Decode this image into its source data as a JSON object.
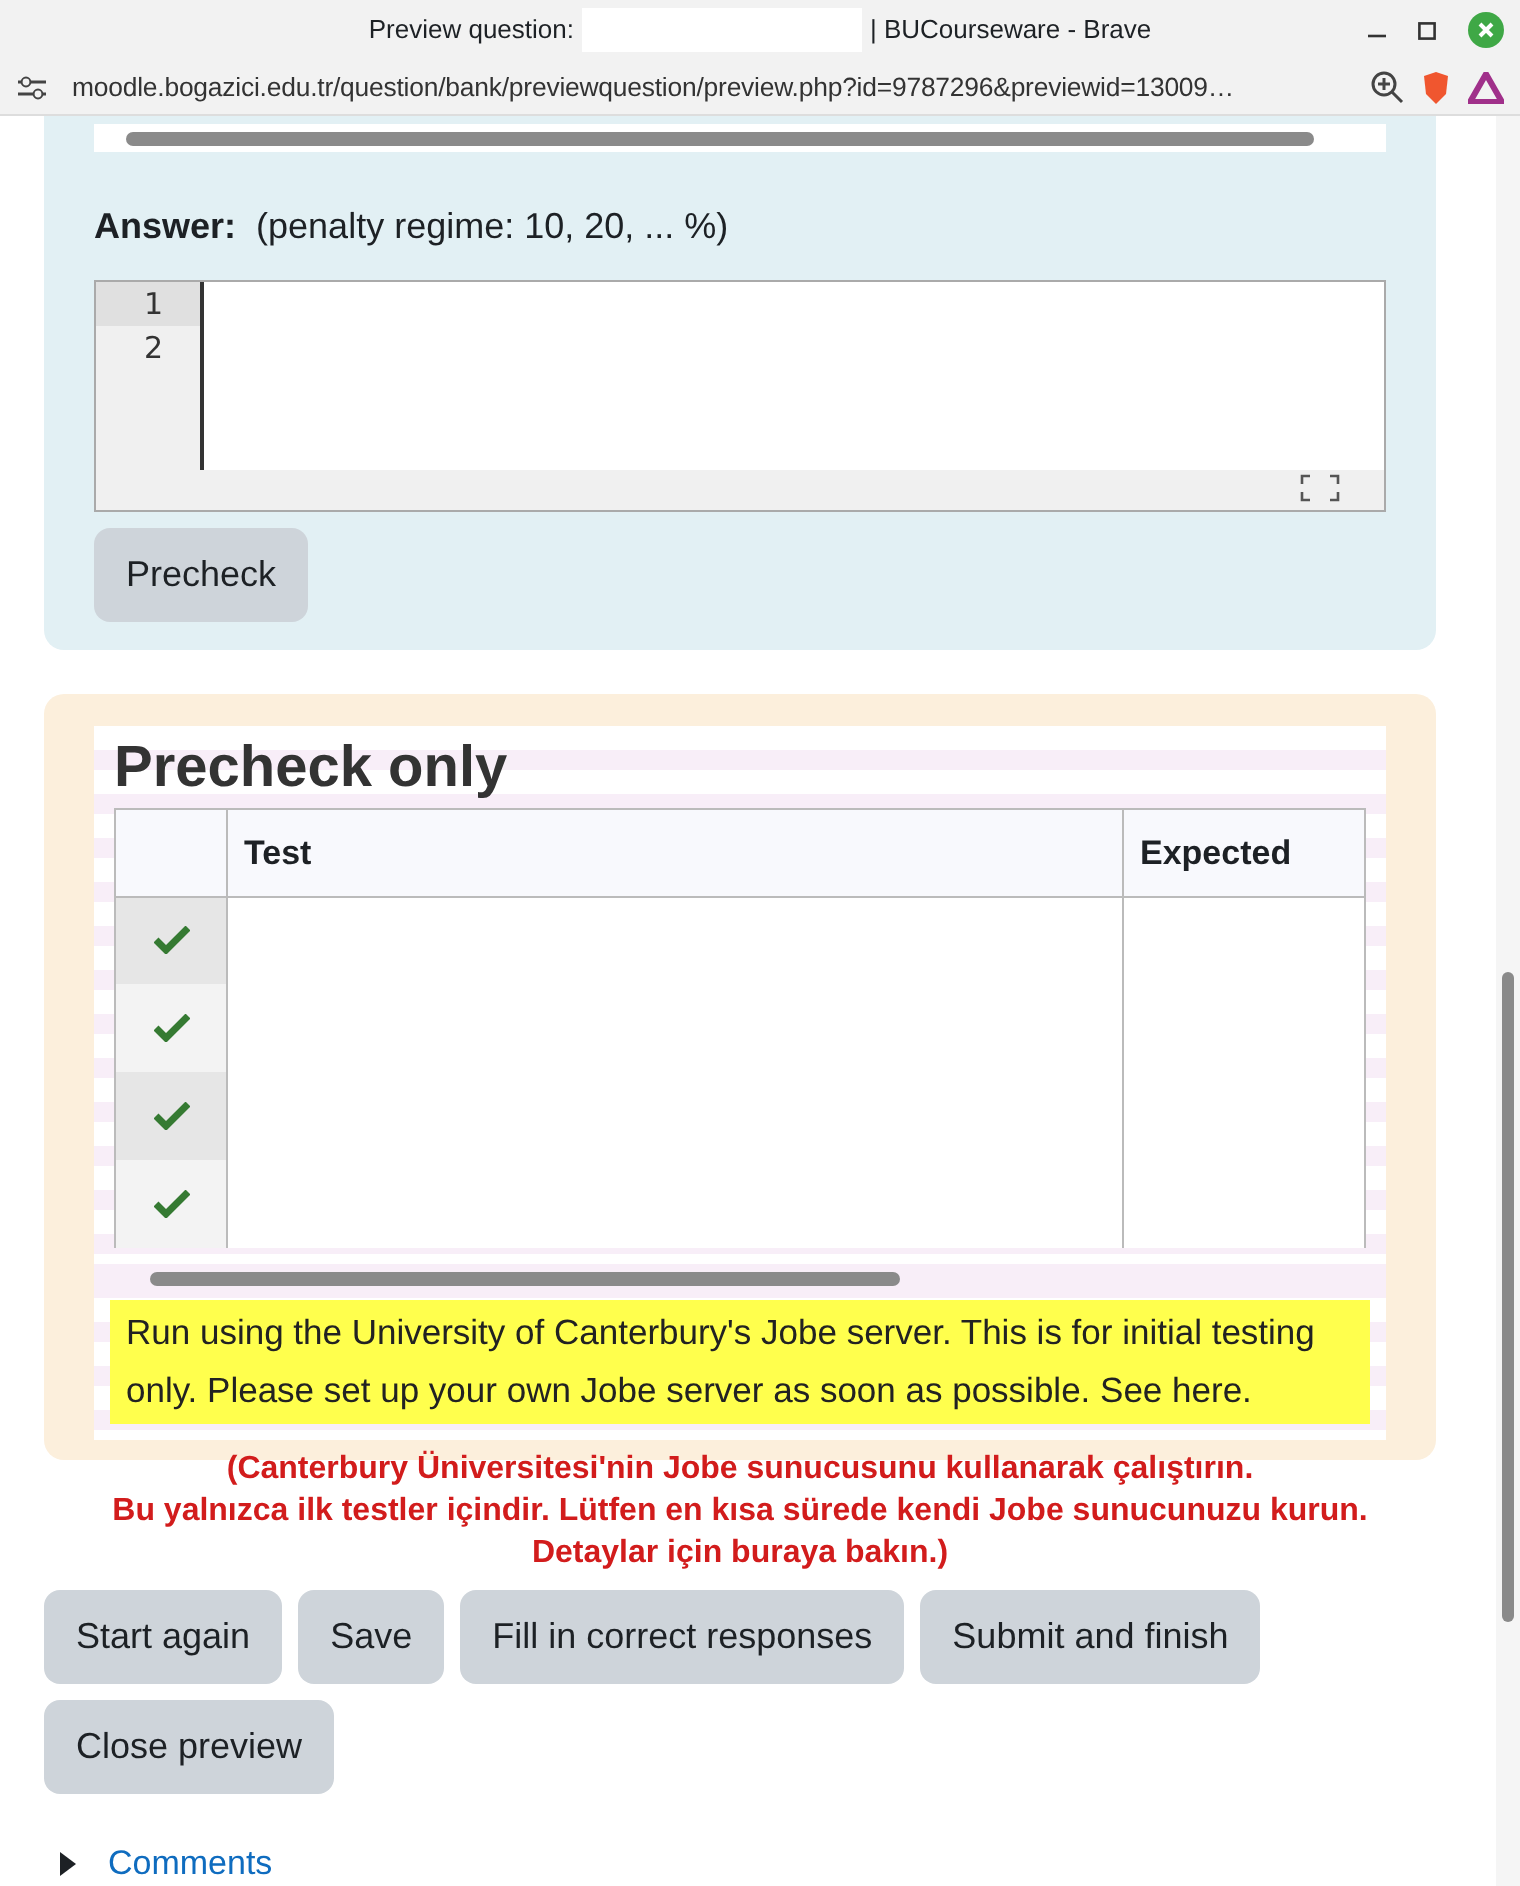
{
  "window": {
    "title_prefix": "Preview question:",
    "title_suffix": "| BUCourseware - Brave"
  },
  "address_bar": {
    "url": "moodle.bogazici.edu.tr/question/bank/previewquestion/preview.php?id=9787296&previewid=13009…"
  },
  "answer": {
    "label": "Answer:",
    "note": "(penalty regime: 10, 20, ... %)",
    "line_numbers": [
      "1",
      "2"
    ]
  },
  "precheck_button": "Precheck",
  "result": {
    "heading": "Precheck only",
    "columns": [
      "Test",
      "Expected"
    ],
    "rows": [
      {
        "passed": true
      },
      {
        "passed": true
      },
      {
        "passed": true
      },
      {
        "passed": true
      }
    ],
    "notice": "Run using the University of Canterbury's Jobe server. This is for initial testing only. Please set up your own Jobe server as soon as possible. See here.",
    "translation": [
      "(Canterbury Üniversitesi'nin Jobe sunucusunu kullanarak çalıştırın.",
      "Bu yalnızca ilk testler içindir. Lütfen en kısa sürede kendi Jobe sunucunuzu kurun.",
      "Detaylar için buraya bakın.)"
    ]
  },
  "buttons": [
    "Start again",
    "Save",
    "Fill in correct responses",
    "Submit and finish",
    "Close preview"
  ],
  "comments": {
    "label": "Comments"
  }
}
